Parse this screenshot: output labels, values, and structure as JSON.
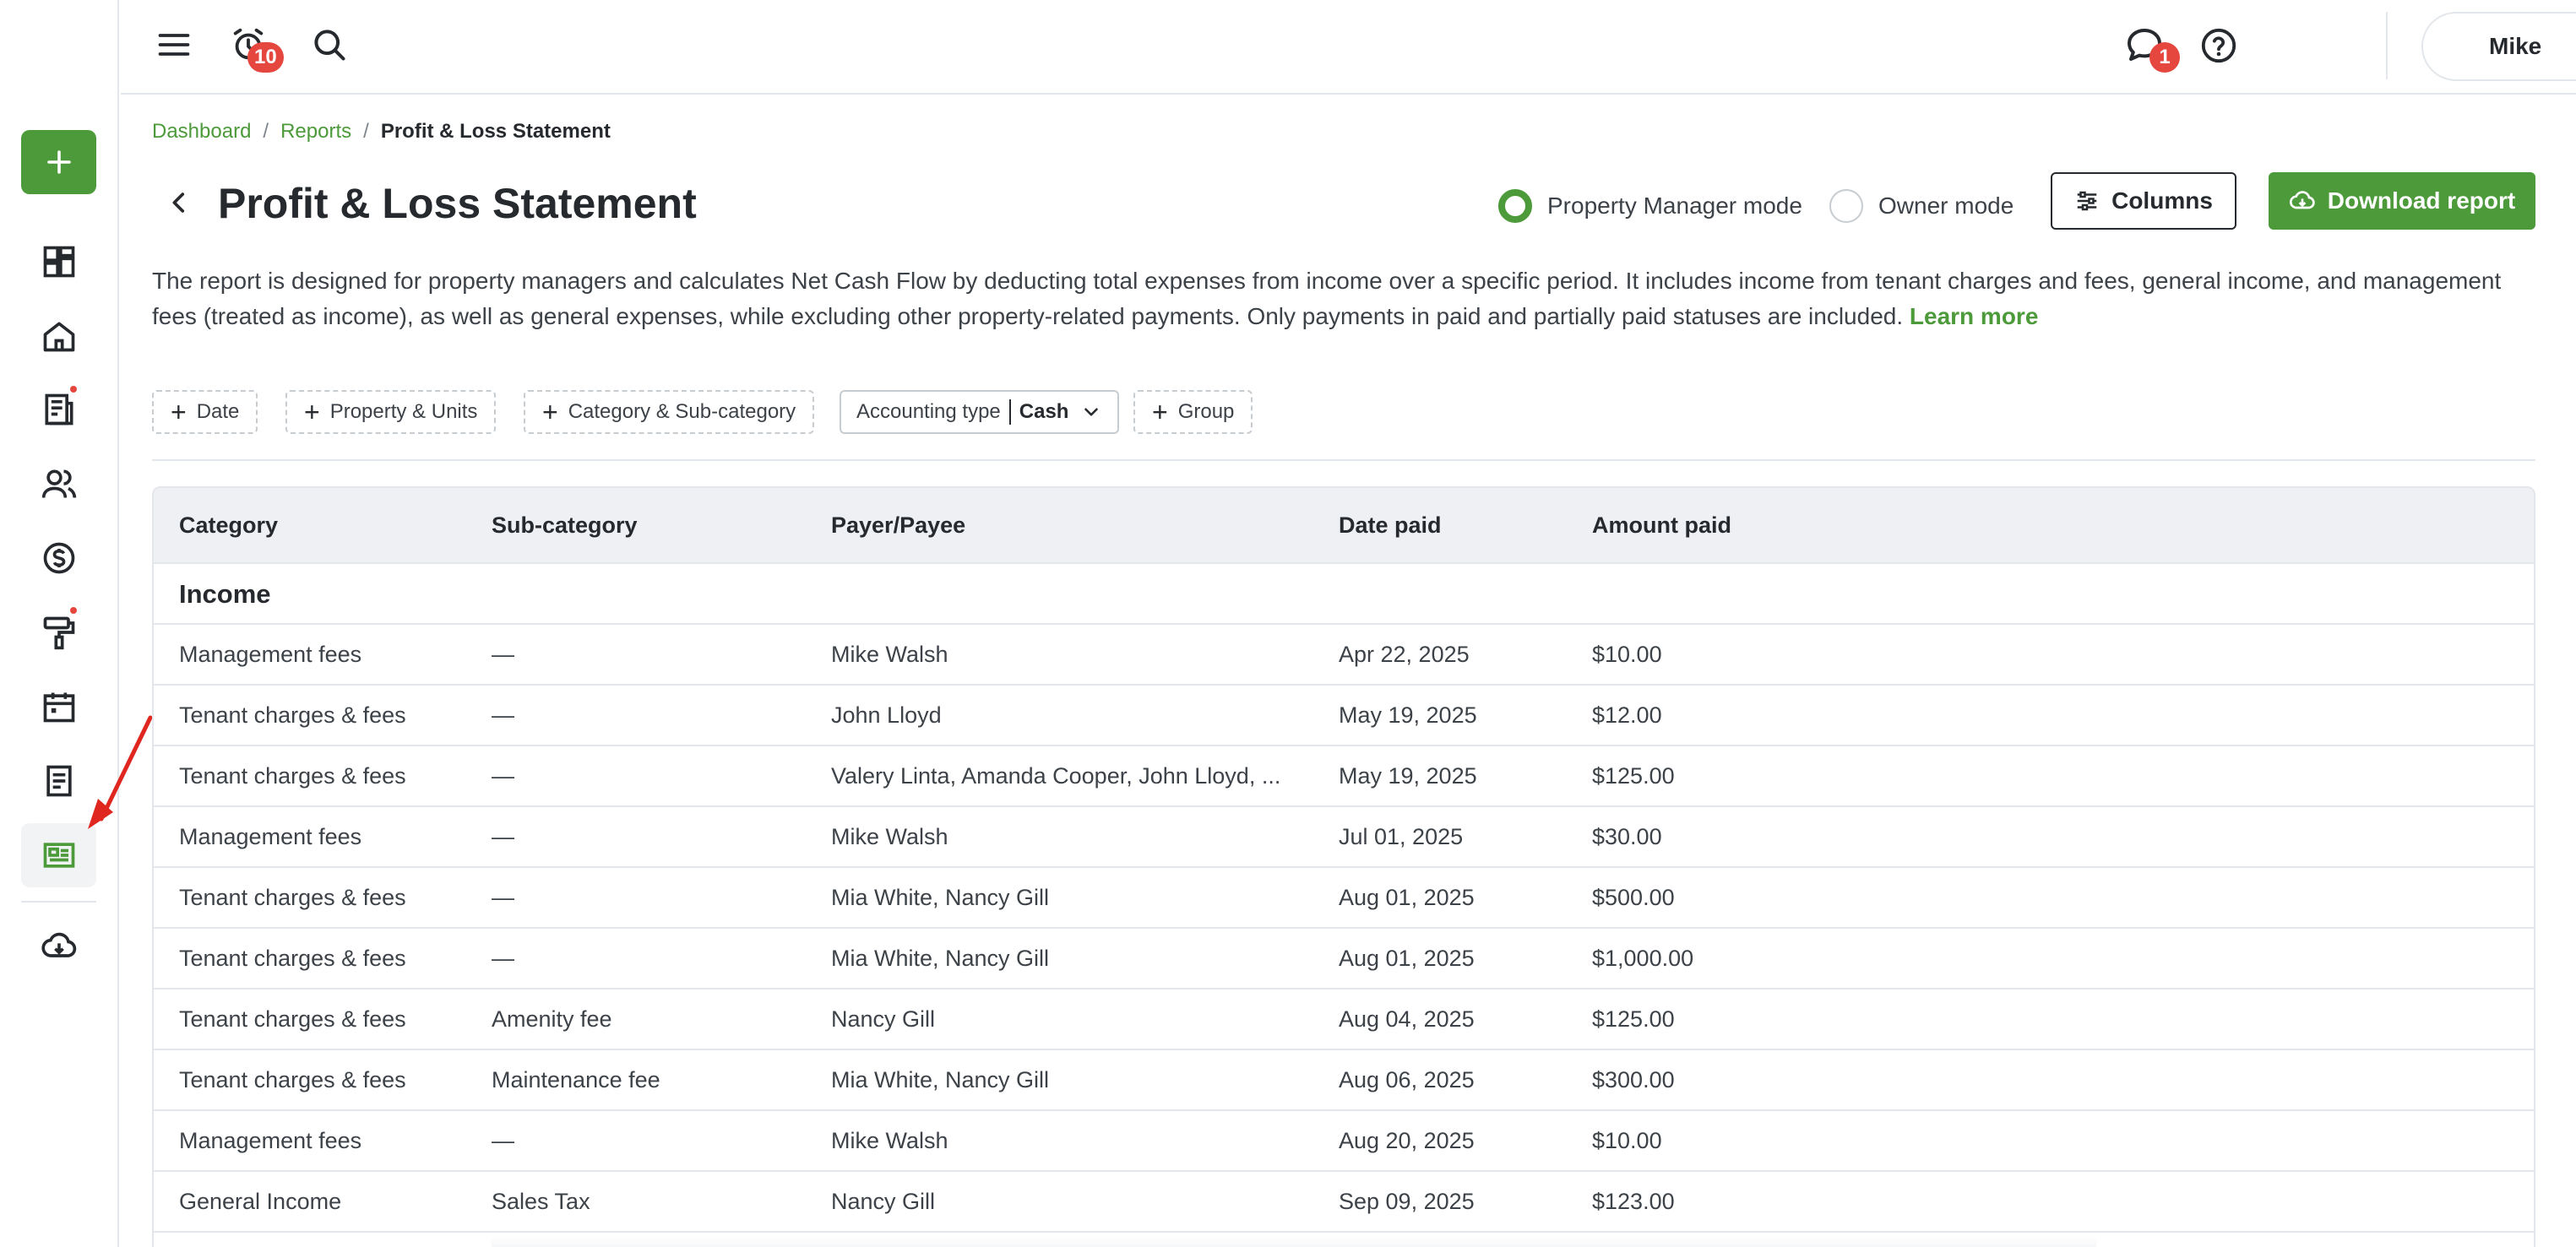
{
  "sidebar": {
    "items": [
      {
        "icon": "dashboard-icon"
      },
      {
        "icon": "home-icon"
      },
      {
        "icon": "news-icon",
        "dot": true
      },
      {
        "icon": "people-icon"
      },
      {
        "icon": "dollar-icon"
      },
      {
        "icon": "paint-roller-icon",
        "dot": true
      },
      {
        "icon": "calendar-icon"
      },
      {
        "icon": "document-icon"
      },
      {
        "icon": "reports-icon",
        "active": true
      },
      {
        "icon": "cloud-download-icon"
      }
    ],
    "accent": "#4c9a3a"
  },
  "topbar": {
    "notification_count": "10",
    "message_count": "1",
    "user_name": "Mike"
  },
  "breadcrumb": {
    "dashboard": "Dashboard",
    "sep1": "/",
    "reports": "Reports",
    "sep2": "/",
    "current": "Profit & Loss Statement"
  },
  "page": {
    "title": "Profit & Loss Statement",
    "mode_pm": "Property Manager mode",
    "mode_owner": "Owner mode",
    "columns_label": "Columns",
    "download_label": "Download report",
    "description": "The report is designed for property managers and calculates Net Cash Flow by deducting total expenses from income over a specific period. It includes income from tenant charges and fees, general income, and management fees (treated as income), as well as general expenses, while excluding other property-related payments. Only payments in paid and partially paid statuses are included.",
    "learn_more": "Learn more"
  },
  "filters": {
    "date": "Date",
    "property": "Property & Units",
    "category": "Category & Sub-category",
    "accounting_label": "Accounting type",
    "accounting_value": "Cash",
    "group": "Group"
  },
  "table": {
    "headers": {
      "category": "Category",
      "subcategory": "Sub-category",
      "payer": "Payer/Payee",
      "date": "Date paid",
      "amount": "Amount paid"
    },
    "section": "Income",
    "rows": [
      {
        "category": "Management fees",
        "subcategory": "—",
        "payer": "Mike Walsh",
        "date": "Apr 22, 2025",
        "amount": "$10.00"
      },
      {
        "category": "Tenant charges & fees",
        "subcategory": "—",
        "payer": "John Lloyd",
        "date": "May 19, 2025",
        "amount": "$12.00"
      },
      {
        "category": "Tenant charges & fees",
        "subcategory": "—",
        "payer": "Valery Linta, Amanda Cooper, John Lloyd, ...",
        "date": "May 19, 2025",
        "amount": "$125.00"
      },
      {
        "category": "Management fees",
        "subcategory": "—",
        "payer": "Mike Walsh",
        "date": "Jul 01, 2025",
        "amount": "$30.00"
      },
      {
        "category": "Tenant charges & fees",
        "subcategory": "—",
        "payer": "Mia White, Nancy Gill",
        "date": "Aug 01, 2025",
        "amount": "$500.00"
      },
      {
        "category": "Tenant charges & fees",
        "subcategory": "—",
        "payer": "Mia White, Nancy Gill",
        "date": "Aug 01, 2025",
        "amount": "$1,000.00"
      },
      {
        "category": "Tenant charges & fees",
        "subcategory": "Amenity fee",
        "payer": "Nancy Gill",
        "date": "Aug 04, 2025",
        "amount": "$125.00"
      },
      {
        "category": "Tenant charges & fees",
        "subcategory": "Maintenance fee",
        "payer": "Mia White, Nancy Gill",
        "date": "Aug 06, 2025",
        "amount": "$300.00"
      },
      {
        "category": "Management fees",
        "subcategory": "—",
        "payer": "Mike Walsh",
        "date": "Aug 20, 2025",
        "amount": "$10.00"
      },
      {
        "category": "General Income",
        "subcategory": "Sales Tax",
        "payer": "Nancy Gill",
        "date": "Sep 09, 2025",
        "amount": "$123.00"
      }
    ]
  }
}
